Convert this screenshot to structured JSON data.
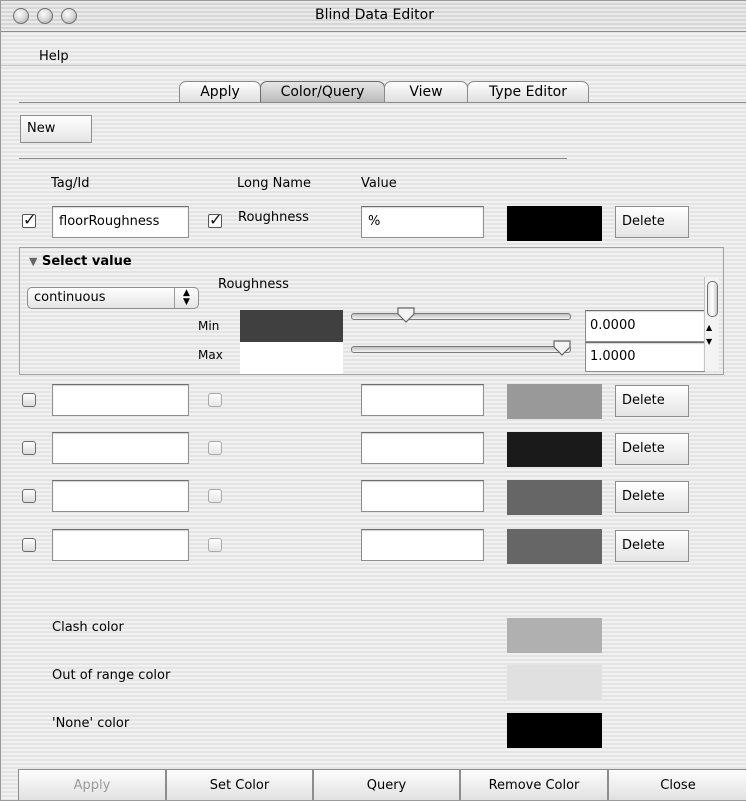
{
  "window": {
    "title": "Blind Data Editor"
  },
  "menu": {
    "help": "Help"
  },
  "tabs": [
    {
      "label": "Apply"
    },
    {
      "label": "Color/Query"
    },
    {
      "label": "View"
    },
    {
      "label": "Type Editor"
    }
  ],
  "toolbar": {
    "new_label": "New"
  },
  "columns": {
    "tag": "Tag/Id",
    "long_name": "Long Name",
    "value": "Value"
  },
  "first_row": {
    "tag": "floorRoughness",
    "long_name": "Roughness",
    "value": "%",
    "color": "#000000",
    "delete": "Delete"
  },
  "select_value": {
    "title": "Select value",
    "dropdown": "continuous",
    "attr_label": "Roughness",
    "min_label": "Min",
    "max_label": "Max",
    "min_color": "#404040",
    "max_color": "#ffffff",
    "min_value": "0.0000",
    "max_value": "1.0000",
    "min_slider_fraction": 0.25,
    "max_slider_fraction": 0.97
  },
  "rows": [
    {
      "color": "#999999",
      "delete": "Delete"
    },
    {
      "color": "#1a1a1a",
      "delete": "Delete"
    },
    {
      "color": "#666666",
      "delete": "Delete"
    },
    {
      "color": "#666666",
      "delete": "Delete"
    }
  ],
  "legend": {
    "clash_label": "Clash color",
    "clash_color": "#b0b0b0",
    "out_of_range_label": "Out of range color",
    "out_of_range_color": "#e0e0e0",
    "none_label": "'None' color",
    "none_color": "#000000"
  },
  "bottom_buttons": {
    "apply": "Apply",
    "set_color": "Set Color",
    "query": "Query",
    "remove_color": "Remove Color",
    "close": "Close"
  }
}
